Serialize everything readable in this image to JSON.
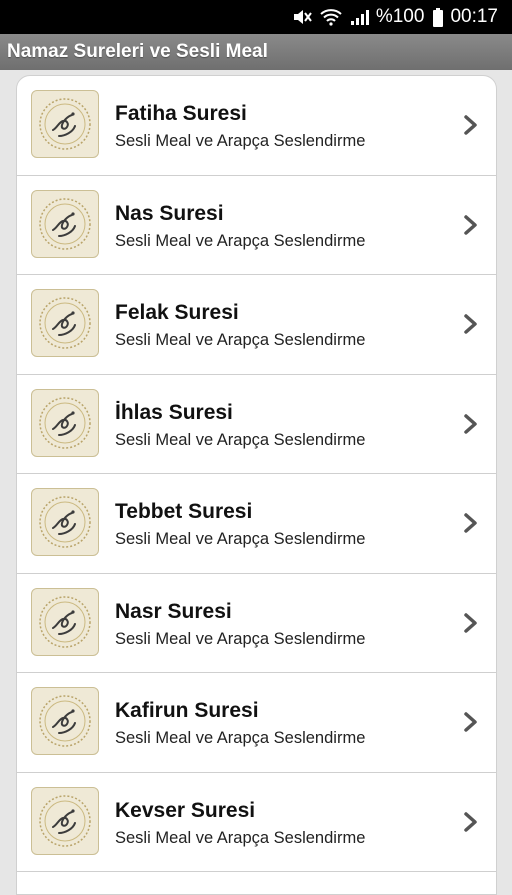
{
  "status_bar": {
    "battery_percent": "%100",
    "time": "00:17",
    "icons": [
      "mute-icon",
      "wifi-icon",
      "signal-icon",
      "battery-icon"
    ]
  },
  "app_bar": {
    "title": "Namaz Sureleri ve Sesli Meal"
  },
  "list": {
    "items": [
      {
        "title": "Fatiha Suresi",
        "subtitle": "Sesli Meal ve Arapça Seslendirme"
      },
      {
        "title": "Nas Suresi",
        "subtitle": "Sesli Meal ve Arapça Seslendirme"
      },
      {
        "title": "Felak Suresi",
        "subtitle": "Sesli Meal ve Arapça Seslendirme"
      },
      {
        "title": "İhlas Suresi",
        "subtitle": "Sesli Meal ve Arapça Seslendirme"
      },
      {
        "title": "Tebbet Suresi",
        "subtitle": "Sesli Meal ve Arapça Seslendirme"
      },
      {
        "title": "Nasr Suresi",
        "subtitle": "Sesli Meal ve Arapça Seslendirme"
      },
      {
        "title": "Kafirun Suresi",
        "subtitle": "Sesli Meal ve Arapça Seslendirme"
      },
      {
        "title": "Kevser Suresi",
        "subtitle": "Sesli Meal ve Arapça Seslendirme"
      }
    ]
  },
  "colors": {
    "app_bar": "#7d7d7d",
    "status_bar": "#000000",
    "background": "#e6e6e6",
    "thumb_bg": "#efe9d6"
  }
}
